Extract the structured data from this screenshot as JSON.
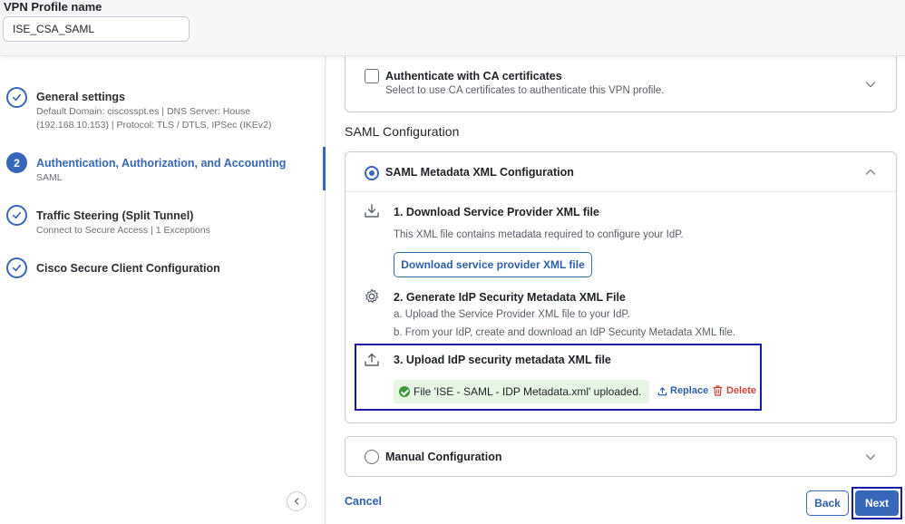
{
  "header": {
    "label": "VPN Profile name",
    "profile_name": "ISE_CSA_SAML"
  },
  "steps": [
    {
      "title": "General settings",
      "subtitle": "Default Domain: ciscosspt.es | DNS Server: House (192.168.10.153) | Protocol: TLS / DTLS, IPSec (IKEv2)",
      "state": "complete"
    },
    {
      "number": "2",
      "title": "Authentication, Authorization, and Accounting",
      "subtitle": "SAML",
      "state": "active"
    },
    {
      "title": "Traffic Steering (Split Tunnel)",
      "subtitle": "Connect to Secure Access | 1 Exceptions",
      "state": "complete"
    },
    {
      "title": "Cisco Secure Client Configuration",
      "state": "complete"
    }
  ],
  "ca_cert": {
    "title": "Authenticate with CA certificates",
    "description": "Select to use CA certificates to authenticate this VPN profile."
  },
  "saml_section": {
    "title": "SAML Configuration",
    "metadata_option": "SAML Metadata XML Configuration",
    "step1_title": "1. Download Service Provider XML file",
    "step1_desc": "This XML file contains metadata required to configure your IdP.",
    "download_button": "Download service provider XML file",
    "step2_title": "2. Generate IdP Security Metadata XML File",
    "step2_a": "a. Upload the Service Provider XML file to your IdP.",
    "step2_b": "b. From your IdP, create and download an IdP Security Metadata XML file.",
    "step3_title": "3. Upload IdP security metadata XML file",
    "upload_status": "File 'ISE - SAML - IDP Metadata.xml' uploaded.",
    "replace_label": "Replace",
    "delete_label": "Delete",
    "manual_option": "Manual Configuration"
  },
  "footer": {
    "cancel_label": "Cancel",
    "back_label": "Back",
    "next_label": "Next"
  },
  "colors": {
    "accent": "#3767b8",
    "highlight": "#1a1aa6",
    "success": "#3a9a3a",
    "danger": "#d0453a"
  }
}
